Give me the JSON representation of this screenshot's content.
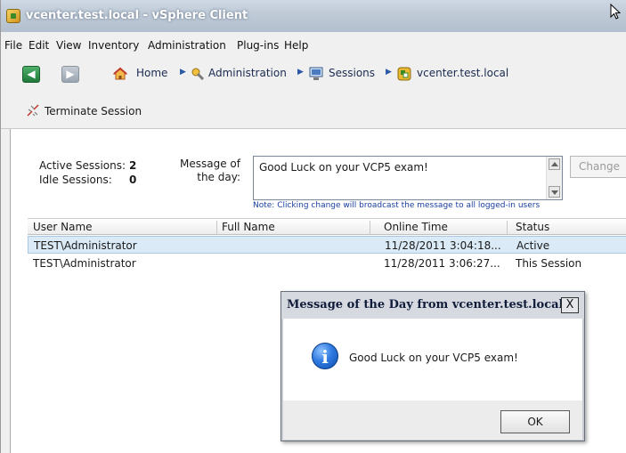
{
  "window": {
    "title": "vcenter.test.local - vSphere Client"
  },
  "menubar": {
    "items": [
      "File",
      "Edit",
      "View",
      "Inventory",
      "Administration",
      "Plug-ins",
      "Help"
    ]
  },
  "breadcrumb": {
    "items": [
      {
        "label": "Home",
        "icon": "home-icon"
      },
      {
        "label": "Administration",
        "icon": "administration-icon"
      },
      {
        "label": "Sessions",
        "icon": "sessions-icon"
      },
      {
        "label": "vcenter.test.local",
        "icon": "vcenter-icon"
      }
    ]
  },
  "actions": {
    "terminate_label": "Terminate Session"
  },
  "sessions": {
    "active_label": "Active Sessions:",
    "active_value": "2",
    "idle_label": "Idle Sessions:",
    "idle_value": "0",
    "motd_label_line1": "Message of",
    "motd_label_line2": "the day:",
    "motd_value": "Good Luck on your VCP5 exam!",
    "change_label": "Change",
    "note": "Note: Clicking change will broadcast the message to all logged-in users"
  },
  "table": {
    "columns": [
      "User Name",
      "Full Name",
      "Online Time",
      "Status"
    ],
    "rows": [
      {
        "user": "TEST\\Administrator",
        "full_name": "",
        "online_time": "11/28/2011 3:04:18...",
        "status": "Active"
      },
      {
        "user": "TEST\\Administrator",
        "full_name": "",
        "online_time": "11/28/2011 3:06:27...",
        "status": "This Session"
      }
    ]
  },
  "dialog": {
    "title": "Message of the Day from vcenter.test.local",
    "close_label": "X",
    "message": "Good Luck on your VCP5 exam!",
    "ok_label": "OK"
  },
  "colors": {
    "titlebar": "#bfcad7",
    "selected_row": "#dbeaf7",
    "note_text": "#1a3fa0",
    "back_button": "#2e8b4a"
  }
}
